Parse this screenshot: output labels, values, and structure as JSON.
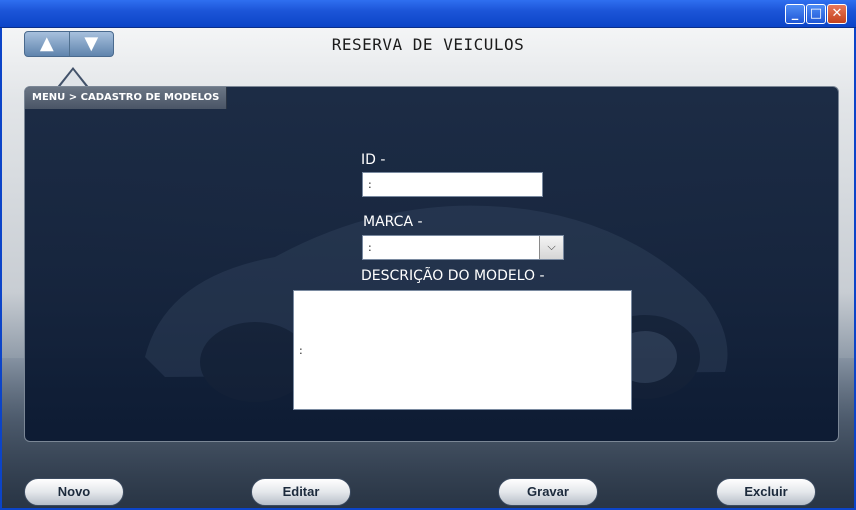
{
  "window": {
    "minimize_glyph": "_",
    "maximize_glyph": "□",
    "close_glyph": "✕"
  },
  "nav": {
    "up_glyph": "▲",
    "down_glyph": "▼"
  },
  "header": {
    "title": "RESERVA DE VEICULOS"
  },
  "breadcrumb": "MENU > CADASTRO DE MODELOS",
  "form": {
    "id_label": "ID -",
    "id_value": ":",
    "marca_label": "MARCA -",
    "marca_value": ":",
    "dropdown_glyph": "⌵",
    "descricao_label": "DESCRIÇÃO DO MODELO -",
    "descricao_value": ":"
  },
  "buttons": {
    "novo": "Novo",
    "editar": "Editar",
    "gravar": "Gravar",
    "excluir": "Excluir"
  },
  "colors": {
    "titlebar": "#1c55d8",
    "panel": "#162640"
  }
}
